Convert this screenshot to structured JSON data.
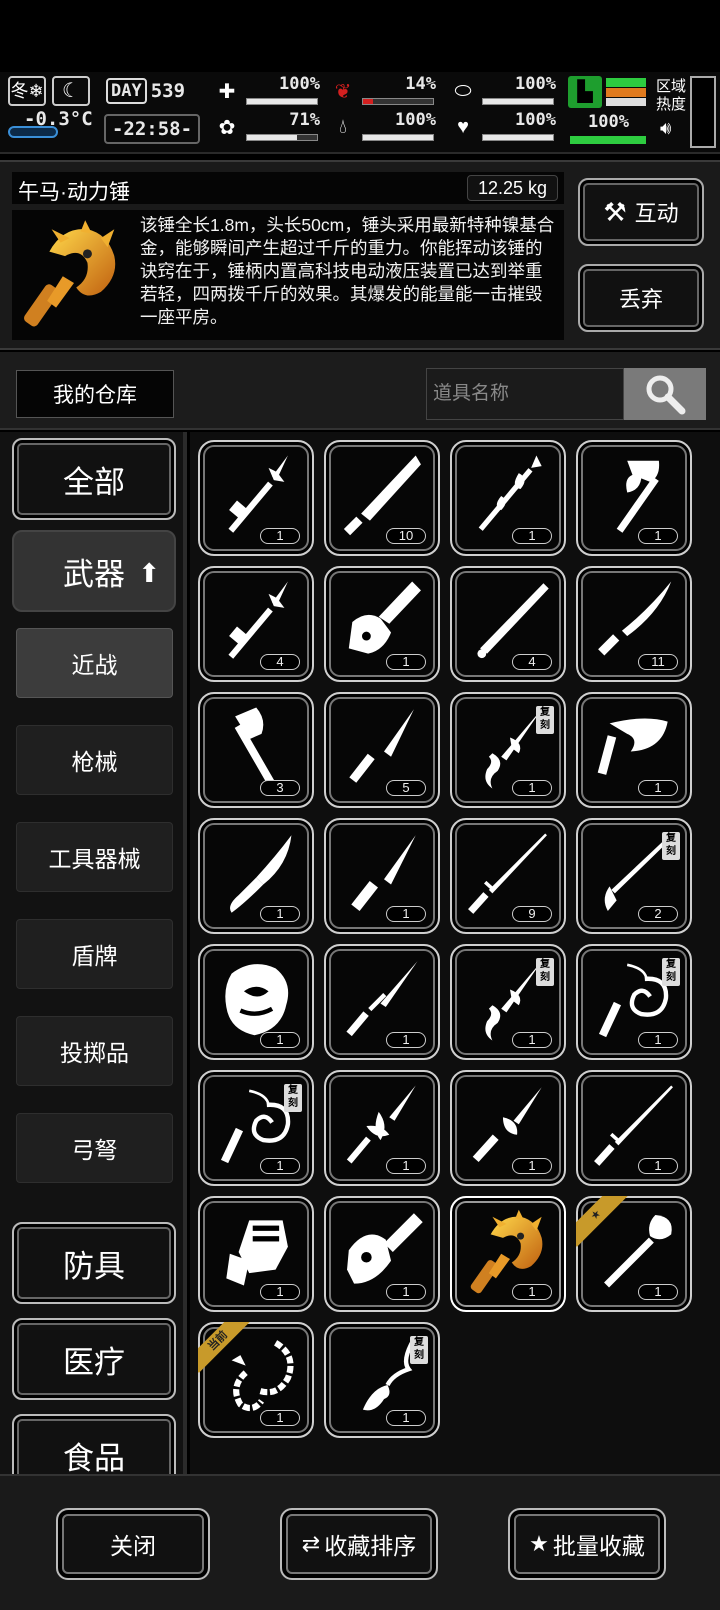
{
  "status": {
    "temperature": "-0.3°C",
    "day_label": "DAY",
    "day_value": "539",
    "time": "-22:58-",
    "meters": [
      {
        "icon": "medkit-icon",
        "value": "100%",
        "fill": 1.0
      },
      {
        "icon": "stomach-icon",
        "value": "14%",
        "fill": 0.14
      },
      {
        "icon": "pill-icon",
        "value": "100%",
        "fill": 1.0
      },
      {
        "icon": "brain-icon",
        "value": "71%",
        "fill": 0.71
      },
      {
        "icon": "water-drop-icon",
        "value": "100%",
        "fill": 1.0
      },
      {
        "icon": "heart-icon",
        "value": "100%",
        "fill": 1.0
      }
    ],
    "battery_value": "100%",
    "region_label_1": "区域",
    "region_label_2": "热度"
  },
  "item": {
    "name": "午马·动力锤",
    "weight": "12.25 kg",
    "description": "该锤全长1.8m，头长50cm，锤头采用最新特种镍基合金，能够瞬间产生超过千斤的重力。你能挥动该锤的诀窍在于，锤柄内置高科技电动液压装置已达到举重若轻，四两拨千斤的效果。其爆发的能量能一击摧毁一座平房。",
    "interact_label": "互动",
    "discard_label": "丢弃"
  },
  "warehouse": {
    "title": "我的仓库",
    "search_placeholder": "道具名称"
  },
  "categories": {
    "all": "全部",
    "weapons": "武器",
    "sub": [
      "近战",
      "枪械",
      "工具器械",
      "盾牌",
      "投掷品",
      "弓弩"
    ],
    "armor": "防具",
    "medical": "医疗",
    "food": "食品"
  },
  "items": [
    {
      "qty": "1",
      "icon": "spear-icon"
    },
    {
      "qty": "10",
      "icon": "machete-icon"
    },
    {
      "qty": "1",
      "icon": "ornate-staff-icon"
    },
    {
      "qty": "1",
      "icon": "axe-hammer-icon"
    },
    {
      "qty": "4",
      "icon": "spear-icon"
    },
    {
      "qty": "1",
      "icon": "chainsaw-icon"
    },
    {
      "qty": "4",
      "icon": "baseball-bat-icon"
    },
    {
      "qty": "11",
      "icon": "curved-blade-icon"
    },
    {
      "qty": "3",
      "icon": "hatchet-icon"
    },
    {
      "qty": "5",
      "icon": "knife-icon"
    },
    {
      "qty": "1",
      "icon": "serpent-sword-icon",
      "copy": "复刻"
    },
    {
      "qty": "1",
      "icon": "kukri-icon"
    },
    {
      "qty": "1",
      "icon": "karambit-icon"
    },
    {
      "qty": "1",
      "icon": "combat-knife-icon"
    },
    {
      "qty": "9",
      "icon": "katana-icon"
    },
    {
      "qty": "2",
      "icon": "long-sword-icon",
      "copy": "复刻"
    },
    {
      "qty": "1",
      "icon": "gauntlet-mask-icon"
    },
    {
      "qty": "1",
      "icon": "sword-icon"
    },
    {
      "qty": "1",
      "icon": "serpent-sword-icon",
      "copy": "复刻"
    },
    {
      "qty": "1",
      "icon": "whip-icon",
      "copy": "复刻"
    },
    {
      "qty": "1",
      "icon": "whip-icon",
      "copy": "复刻"
    },
    {
      "qty": "1",
      "icon": "winged-spear-icon"
    },
    {
      "qty": "1",
      "icon": "winged-dagger-icon"
    },
    {
      "qty": "1",
      "icon": "katana-icon"
    },
    {
      "qty": "1",
      "icon": "power-gauntlet-icon"
    },
    {
      "qty": "1",
      "icon": "dragon-chainsaw-icon"
    },
    {
      "qty": "1",
      "icon": "power-hammer-icon",
      "selected": true
    },
    {
      "qty": "1",
      "icon": "shovel-icon",
      "star": true
    },
    {
      "qty": "1",
      "icon": "scorpion-whip-icon",
      "ribbon": "当前"
    },
    {
      "qty": "1",
      "icon": "brush-staff-icon",
      "copy": "复刻"
    }
  ],
  "footer": {
    "close": "关闭",
    "sort": "收藏排序",
    "batch": "批量收藏"
  },
  "colors": {
    "accent_gold": "#c89a2a",
    "stomach_red": "#d42020",
    "battery_green": "#2ecc40"
  }
}
